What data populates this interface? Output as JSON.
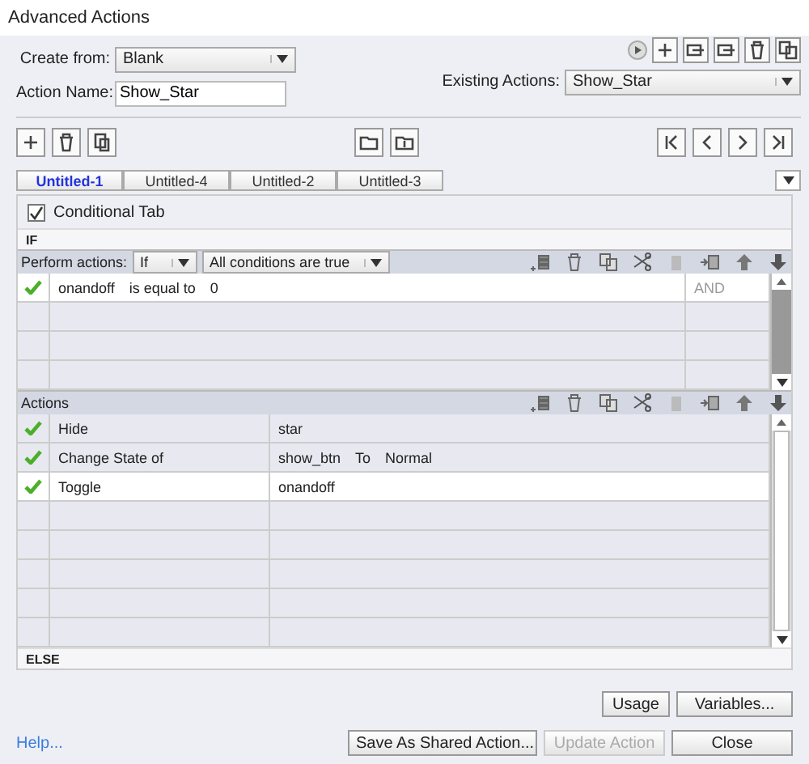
{
  "window": {
    "title": "Advanced Actions"
  },
  "create_from": {
    "label": "Create from:",
    "value": "Blank"
  },
  "action_name": {
    "label": "Action Name:",
    "value": "Show_Star"
  },
  "existing_actions": {
    "label": "Existing Actions:",
    "value": "Show_Star"
  },
  "tabs": [
    {
      "label": "Untitled-1",
      "selected": true
    },
    {
      "label": "Untitled-4",
      "selected": false
    },
    {
      "label": "Untitled-2",
      "selected": false
    },
    {
      "label": "Untitled-3",
      "selected": false
    }
  ],
  "conditional_tab": {
    "label": "Conditional Tab",
    "checked": true
  },
  "if_section": {
    "title": "IF",
    "perform_label": "Perform actions:",
    "perform_value": "If",
    "match_value": "All conditions are true",
    "conditions": [
      {
        "parts": [
          "onandoff",
          "is equal to",
          "0"
        ],
        "enabled": true,
        "operator": "AND"
      }
    ]
  },
  "actions_section": {
    "title": "Actions",
    "rows": [
      {
        "action": "Hide",
        "target": [
          "star"
        ],
        "enabled": true,
        "selected": false
      },
      {
        "action": "Change State of",
        "target": [
          "show_btn",
          "To",
          "Normal"
        ],
        "enabled": true,
        "selected": false
      },
      {
        "action": "Toggle",
        "target": [
          "onandoff"
        ],
        "enabled": true,
        "selected": true
      }
    ]
  },
  "else_section": {
    "title": "ELSE"
  },
  "buttons": [
    {
      "label": "Usage",
      "disabled": false
    },
    {
      "label": "Variables...",
      "disabled": false
    }
  ],
  "help_link": "Help...",
  "footer_buttons": [
    {
      "label": "Save As Shared Action...",
      "disabled": false
    },
    {
      "label": "Update Action",
      "disabled": true
    },
    {
      "label": "Close",
      "disabled": false
    }
  ]
}
